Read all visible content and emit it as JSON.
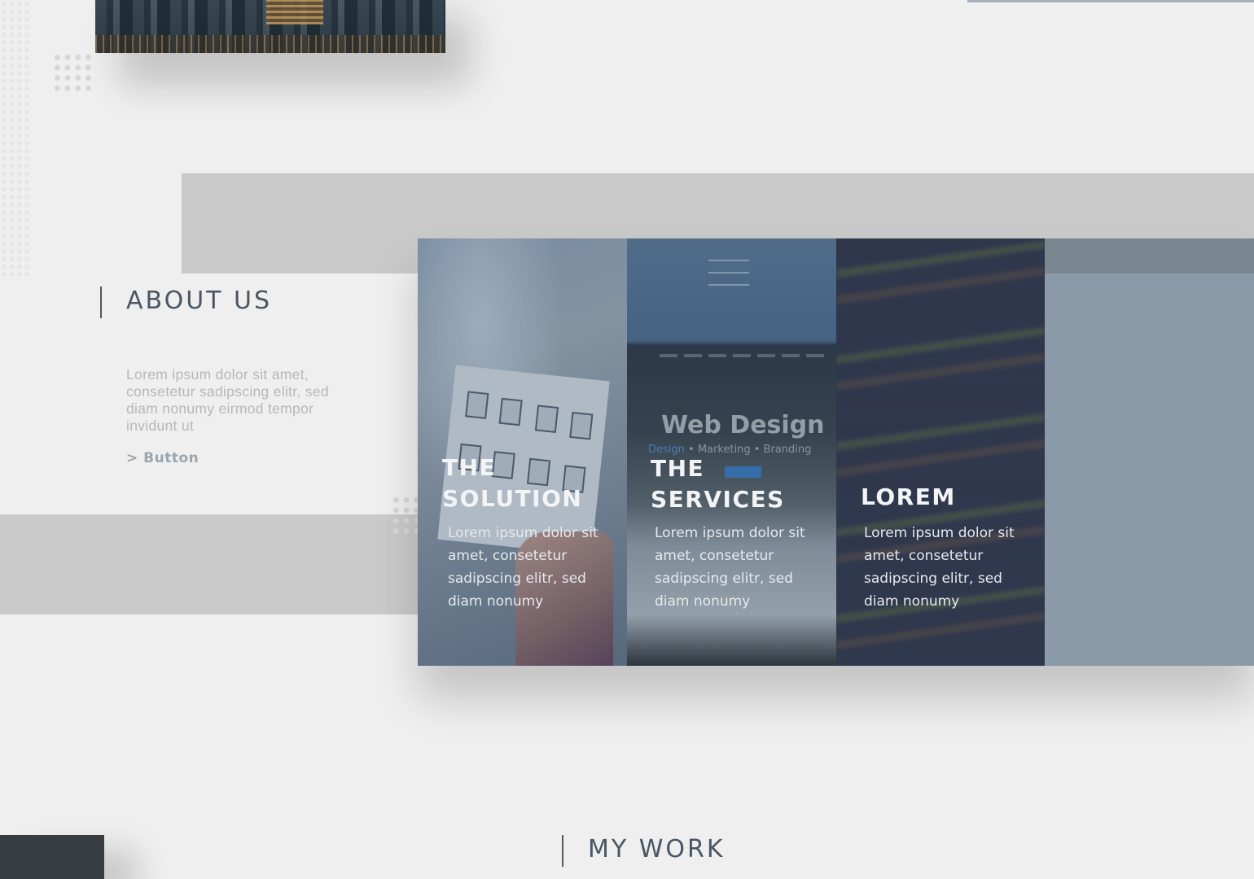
{
  "about": {
    "title": "ABOUT US",
    "text": "Lorem ipsum dolor sit amet, consetetur sadipscing elitr, sed diam nonumy eirmod tempor invidunt ut",
    "button_label": "> Button"
  },
  "panels": [
    {
      "title": "THE SOLUTION",
      "text": "Lorem ipsum dolor sit amet, consetetur sadipscing elitr, sed diam nonumy"
    },
    {
      "title": "THE SERVICES",
      "text": "Lorem ipsum dolor sit amet, consetetur sadipscing elitr, sed diam nonumy",
      "image_text": "Web Design",
      "image_tags": "Design • Marketing • Branding"
    },
    {
      "title": "LOREM",
      "text": "Lorem ipsum dolor sit amet, consetetur sadipscing elitr, sed diam nonumy"
    }
  ],
  "work": {
    "title": "MY WORK"
  },
  "colors": {
    "background": "#efefef",
    "heading": "#4a5663",
    "band": "#c9c9c9",
    "panel_slate": "#8a9aa8",
    "dark_block": "#363c41"
  }
}
